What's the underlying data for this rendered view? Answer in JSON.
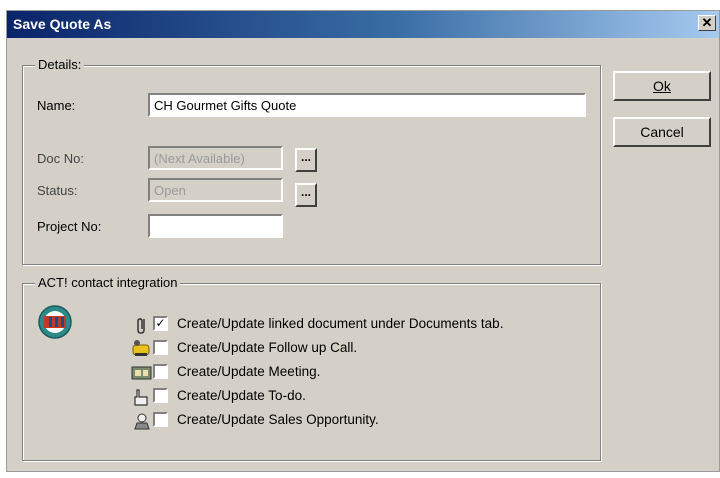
{
  "window": {
    "title": "Save Quote As",
    "close_glyph": "✕",
    "close_icon": "close-icon"
  },
  "details": {
    "group_label": "Details:",
    "name_label": "Name:",
    "name_value": "CH Gourmet Gifts Quote",
    "doc_no_label": "Doc No:",
    "doc_no_value": "(Next Available)",
    "status_label": "Status:",
    "status_value": "Open",
    "project_no_label": "Project No:",
    "project_no_value": "",
    "ellipsis_label": "..."
  },
  "buttons": {
    "ok": "Ok",
    "cancel": "Cancel"
  },
  "integration": {
    "group_label": "ACT! contact integration",
    "logo_icon": "act-logo-icon",
    "items": [
      {
        "label": "Create/Update linked document under Documents tab.",
        "checked": true,
        "icon": "paperclip-icon",
        "check": "✓"
      },
      {
        "label": "Create/Update Follow up Call.",
        "checked": false,
        "icon": "phone-call-icon",
        "check": ""
      },
      {
        "label": "Create/Update Meeting.",
        "checked": false,
        "icon": "meeting-icon",
        "check": ""
      },
      {
        "label": "Create/Update To-do.",
        "checked": false,
        "icon": "todo-hand-icon",
        "check": ""
      },
      {
        "label": "Create/Update Sales Opportunity.",
        "checked": false,
        "icon": "sales-opportunity-icon",
        "check": ""
      }
    ]
  },
  "colors": {
    "dialog_face": "#d4d0c8",
    "titlebar_start": "#0a246a",
    "titlebar_end": "#a6caf0"
  }
}
